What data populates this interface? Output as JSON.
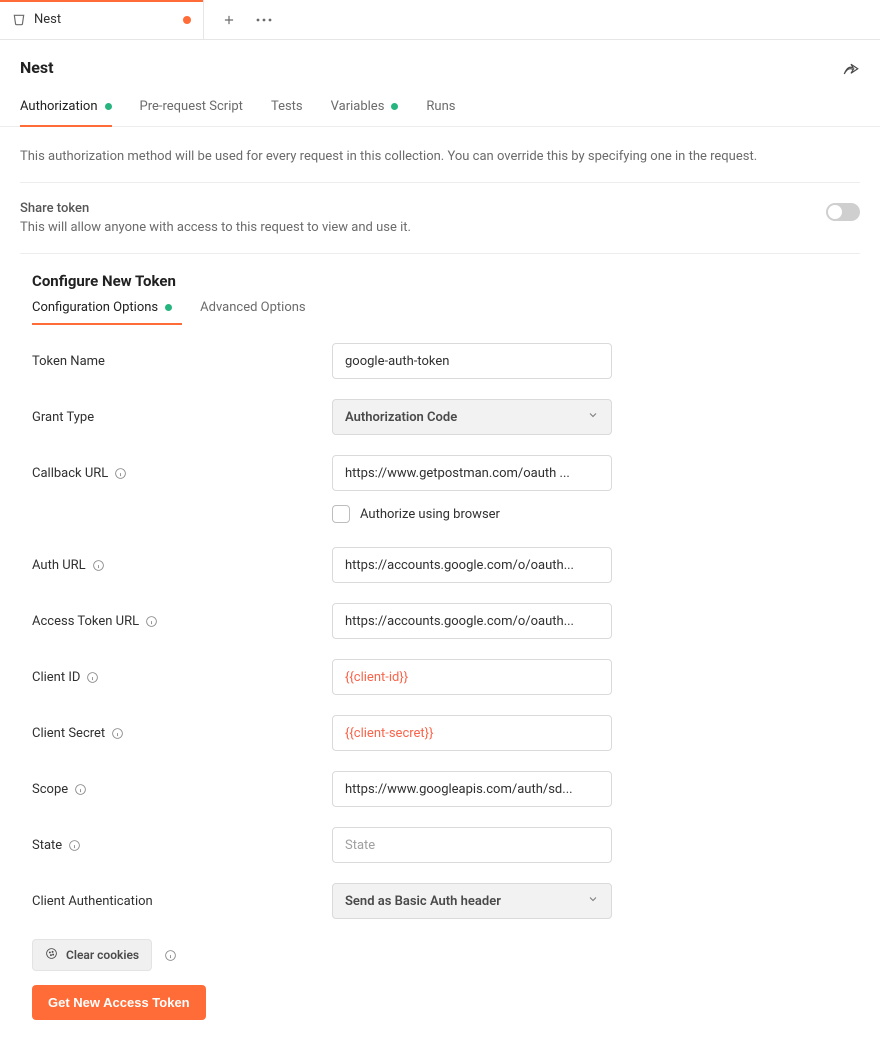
{
  "topTab": {
    "label": "Nest"
  },
  "collection": {
    "title": "Nest"
  },
  "reqTabs": {
    "authorization": "Authorization",
    "prerequest": "Pre-request Script",
    "tests": "Tests",
    "variables": "Variables",
    "runs": "Runs"
  },
  "authDescription": "This authorization method will be used for every request in this collection. You can override this by specifying one in the request.",
  "shareToken": {
    "label": "Share token",
    "sub": "This will allow anyone with access to this request to view and use it."
  },
  "sectionTitle": "Configure New Token",
  "subTabs": {
    "config": "Configuration Options",
    "advanced": "Advanced Options"
  },
  "fields": {
    "tokenName": {
      "label": "Token Name",
      "value": "google-auth-token"
    },
    "grantType": {
      "label": "Grant Type",
      "value": "Authorization Code"
    },
    "callbackUrl": {
      "label": "Callback URL",
      "value": "https://www.getpostman.com/oauth ..."
    },
    "authorizeBrowser": {
      "label": "Authorize using browser"
    },
    "authUrl": {
      "label": "Auth URL",
      "value": "https://accounts.google.com/o/oauth..."
    },
    "accessTokenUrl": {
      "label": "Access Token URL",
      "value": "https://accounts.google.com/o/oauth..."
    },
    "clientId": {
      "label": "Client ID",
      "value": "{{client-id}}"
    },
    "clientSecret": {
      "label": "Client Secret",
      "value": "{{client-secret}}"
    },
    "scope": {
      "label": "Scope",
      "value": "https://www.googleapis.com/auth/sd..."
    },
    "state": {
      "label": "State",
      "placeholder": "State",
      "value": ""
    },
    "clientAuth": {
      "label": "Client Authentication",
      "value": "Send as Basic Auth header"
    }
  },
  "buttons": {
    "clearCookies": "Clear cookies",
    "getToken": "Get New Access Token"
  }
}
